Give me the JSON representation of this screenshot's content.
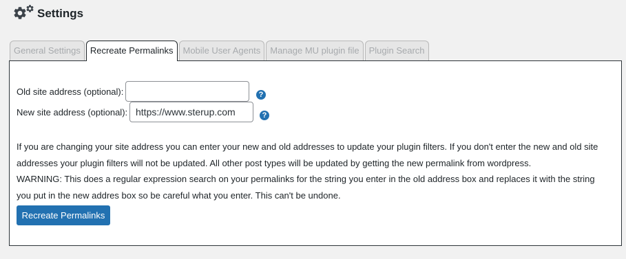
{
  "header": {
    "title": "Settings",
    "icon": "gear-icon"
  },
  "tabs": [
    {
      "label": "General Settings",
      "active": false
    },
    {
      "label": "Recreate Permalinks",
      "active": true
    },
    {
      "label": "Mobile User Agents",
      "active": false
    },
    {
      "label": "Manage MU plugin file",
      "active": false
    },
    {
      "label": "Plugin Search",
      "active": false
    }
  ],
  "form": {
    "old_address": {
      "label": "Old site address (optional):",
      "value": "",
      "help_icon": "?"
    },
    "new_address": {
      "label": "New site address (optional):",
      "value": "https://www.sterup.com",
      "help_icon": "?"
    }
  },
  "description": {
    "paragraph": "If you are changing your site address you can enter your new and old addresses to update your plugin filters. If you don't enter the new and old site addresses your plugin filters will not be updated. All other post types will be updated by getting the new permalink from wordpress.",
    "warning": "WARNING: This does a regular expression search on your permalinks for the string you enter in the old address box and replaces it with the string you put in the new addres box so be careful what you enter. This can't be undone."
  },
  "button": {
    "label": "Recreate Permalinks"
  },
  "colors": {
    "primary": "#2271b1",
    "background": "#f1f1f1",
    "panel": "#ffffff"
  }
}
